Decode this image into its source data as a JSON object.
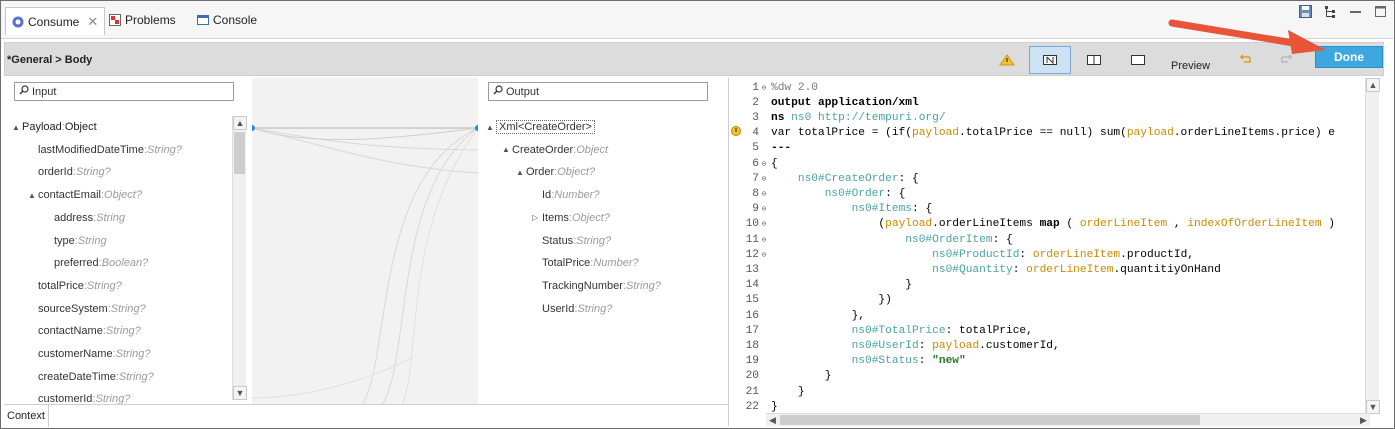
{
  "tabs": {
    "consume": "Consume",
    "problems": "Problems",
    "console": "Console"
  },
  "toolbar": {
    "breadcrumb": "*General > Body",
    "preview_label": "Preview",
    "done_label": "Done"
  },
  "input_panel": {
    "search_placeholder": "Input",
    "items": [
      {
        "name": "Payload",
        "type": "Object",
        "level": 0,
        "expander": "▲"
      },
      {
        "name": "lastModifiedDateTime",
        "type": "String?",
        "level": 1
      },
      {
        "name": "orderId",
        "type": "String?",
        "level": 1
      },
      {
        "name": "contactEmail",
        "type": "Object?",
        "level": 1,
        "expander": "▲"
      },
      {
        "name": "address",
        "type": "String",
        "level": 2
      },
      {
        "name": "type",
        "type": "String",
        "level": 2
      },
      {
        "name": "preferred",
        "type": "Boolean?",
        "level": 2
      },
      {
        "name": "totalPrice",
        "type": "String?",
        "level": 1
      },
      {
        "name": "sourceSystem",
        "type": "String?",
        "level": 1
      },
      {
        "name": "contactName",
        "type": "String?",
        "level": 1
      },
      {
        "name": "customerName",
        "type": "String?",
        "level": 1
      },
      {
        "name": "createDateTime",
        "type": "String?",
        "level": 1
      },
      {
        "name": "customerId",
        "type": "String?",
        "level": 1
      }
    ],
    "context_label": "Context"
  },
  "output_panel": {
    "search_placeholder": "Output",
    "items": [
      {
        "name": "Xml<CreateOrder>",
        "type": "",
        "level": 0,
        "expander": "▲"
      },
      {
        "name": "CreateOrder",
        "type": "Object",
        "level": 1,
        "expander": "▲"
      },
      {
        "name": "Order",
        "type": "Object?",
        "level": 2,
        "expander": "▲"
      },
      {
        "name": "Id",
        "type": "Number?",
        "level": 3
      },
      {
        "name": "Items",
        "type": "Object?",
        "level": 3,
        "expander": "▷"
      },
      {
        "name": "Status",
        "type": "String?",
        "level": 3
      },
      {
        "name": "TotalPrice",
        "type": "Number?",
        "level": 3
      },
      {
        "name": "TrackingNumber",
        "type": "String?",
        "level": 3
      },
      {
        "name": "UserId",
        "type": "String?",
        "level": 3
      }
    ]
  },
  "code": {
    "lines": [
      {
        "n": "1",
        "fold": "⊖",
        "segs": [
          [
            "c-cm",
            "%dw 2.0"
          ]
        ]
      },
      {
        "n": "2",
        "fold": "",
        "segs": [
          [
            "c-kw",
            "output application/xml"
          ]
        ]
      },
      {
        "n": "3",
        "fold": "",
        "segs": [
          [
            "c-kw",
            "ns "
          ],
          [
            "c-ns",
            "ns0 "
          ],
          [
            "c-url",
            "http://tempuri.org/"
          ]
        ]
      },
      {
        "n": "4",
        "fold": "",
        "segs": [
          [
            "c-plain",
            "var totalPrice = (if("
          ],
          [
            "c-pay",
            "payload"
          ],
          [
            "c-plain",
            ".totalPrice == null) sum("
          ],
          [
            "c-pay",
            "payload"
          ],
          [
            "c-plain",
            ".orderLineItems.price) e"
          ]
        ]
      },
      {
        "n": "5",
        "fold": "",
        "segs": [
          [
            "c-kw",
            "---"
          ]
        ]
      },
      {
        "n": "6",
        "fold": "⊖",
        "segs": [
          [
            "c-plain",
            "{"
          ]
        ]
      },
      {
        "n": "7",
        "fold": "⊖",
        "segs": [
          [
            "c-plain",
            "    "
          ],
          [
            "c-ns",
            "ns0#CreateOrder"
          ],
          [
            "c-plain",
            ": {"
          ]
        ]
      },
      {
        "n": "8",
        "fold": "⊖",
        "segs": [
          [
            "c-plain",
            "        "
          ],
          [
            "c-ns",
            "ns0#Order"
          ],
          [
            "c-plain",
            ": {"
          ]
        ]
      },
      {
        "n": "9",
        "fold": "⊖",
        "segs": [
          [
            "c-plain",
            "            "
          ],
          [
            "c-ns",
            "ns0#Items"
          ],
          [
            "c-plain",
            ": {"
          ]
        ]
      },
      {
        "n": "10",
        "fold": "⊖",
        "segs": [
          [
            "c-plain",
            "                ("
          ],
          [
            "c-pay",
            "payload"
          ],
          [
            "c-plain",
            ".orderLineItems "
          ],
          [
            "c-kw",
            "map"
          ],
          [
            "c-plain",
            " ( "
          ],
          [
            "c-pay",
            "orderLineItem"
          ],
          [
            "c-plain",
            " , "
          ],
          [
            "c-pay",
            "indexOfOrderLineItem"
          ],
          [
            "c-plain",
            " )"
          ]
        ]
      },
      {
        "n": "11",
        "fold": "⊖",
        "segs": [
          [
            "c-plain",
            "                    "
          ],
          [
            "c-ns",
            "ns0#OrderItem"
          ],
          [
            "c-plain",
            ": {"
          ]
        ]
      },
      {
        "n": "12",
        "fold": "⊖",
        "segs": [
          [
            "c-plain",
            "                        "
          ],
          [
            "c-ns",
            "ns0#ProductId"
          ],
          [
            "c-plain",
            ": "
          ],
          [
            "c-pay",
            "orderLineItem"
          ],
          [
            "c-plain",
            ".productId,"
          ]
        ]
      },
      {
        "n": "13",
        "fold": "",
        "segs": [
          [
            "c-plain",
            "                        "
          ],
          [
            "c-ns",
            "ns0#Quantity"
          ],
          [
            "c-plain",
            ": "
          ],
          [
            "c-pay",
            "orderLineItem"
          ],
          [
            "c-plain",
            ".quantitiyOnHand"
          ]
        ]
      },
      {
        "n": "14",
        "fold": "",
        "segs": [
          [
            "c-plain",
            "                    }"
          ]
        ]
      },
      {
        "n": "15",
        "fold": "",
        "segs": [
          [
            "c-plain",
            "                })"
          ]
        ]
      },
      {
        "n": "16",
        "fold": "",
        "segs": [
          [
            "c-plain",
            "            },"
          ]
        ]
      },
      {
        "n": "17",
        "fold": "",
        "segs": [
          [
            "c-plain",
            "            "
          ],
          [
            "c-ns",
            "ns0#TotalPrice"
          ],
          [
            "c-plain",
            ": totalPrice,"
          ]
        ]
      },
      {
        "n": "18",
        "fold": "",
        "segs": [
          [
            "c-plain",
            "            "
          ],
          [
            "c-ns",
            "ns0#UserId"
          ],
          [
            "c-plain",
            ": "
          ],
          [
            "c-pay",
            "payload"
          ],
          [
            "c-plain",
            ".customerId,"
          ]
        ]
      },
      {
        "n": "19",
        "fold": "",
        "segs": [
          [
            "c-plain",
            "            "
          ],
          [
            "c-ns",
            "ns0#Status"
          ],
          [
            "c-plain",
            ": "
          ],
          [
            "c-str",
            "\"new\""
          ]
        ]
      },
      {
        "n": "20",
        "fold": "",
        "segs": [
          [
            "c-plain",
            "        }"
          ]
        ]
      },
      {
        "n": "21",
        "fold": "",
        "segs": [
          [
            "c-plain",
            "    }"
          ]
        ]
      },
      {
        "n": "22",
        "fold": "",
        "segs": [
          [
            "c-plain",
            "}"
          ]
        ]
      }
    ]
  },
  "colors": {
    "done_bg": "#3ea7e0",
    "annotation_arrow": "#e8543a",
    "payload_kw": "#cc8a00",
    "namespace": "#4aa3a3"
  }
}
